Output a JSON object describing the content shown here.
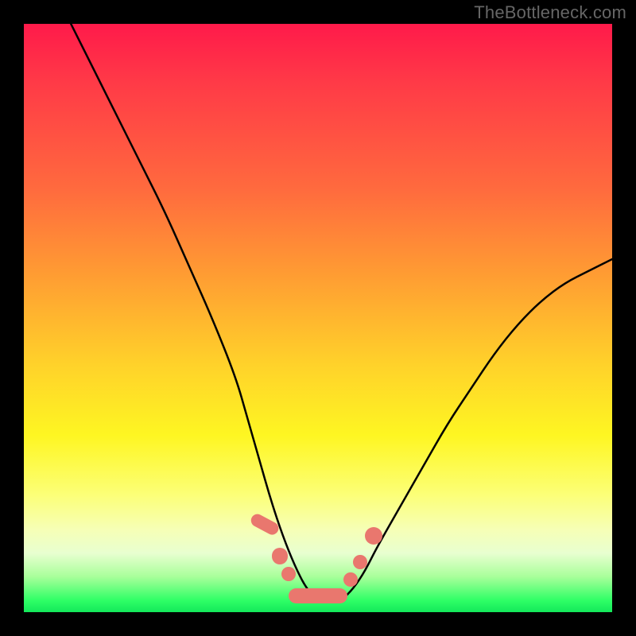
{
  "watermark": "TheBottleneck.com",
  "colors": {
    "frame": "#000000",
    "marker": "#e9776e",
    "curve": "#000000"
  },
  "chart_data": {
    "type": "line",
    "title": "",
    "xlabel": "",
    "ylabel": "",
    "xlim": [
      0,
      100
    ],
    "ylim": [
      0,
      100
    ],
    "grid": false,
    "legend": null,
    "note": "Values in percent of plot area. y=100 is top (red), y=0 is bottom (green). Curve is a V-shaped bottleneck profile with flat bottom and pink markers near the trough.",
    "series": [
      {
        "name": "bottleneck-curve",
        "x": [
          8,
          12,
          16,
          20,
          24,
          28,
          32,
          36,
          38,
          40,
          42,
          44,
          46,
          48,
          50,
          52,
          54,
          56,
          58,
          60,
          64,
          68,
          72,
          76,
          80,
          84,
          88,
          92,
          96,
          100
        ],
        "y": [
          100,
          92,
          84,
          76,
          68,
          59,
          50,
          40,
          33,
          26,
          19,
          13,
          8,
          4,
          2,
          2,
          2,
          4,
          7,
          11,
          18,
          25,
          32,
          38,
          44,
          49,
          53,
          56,
          58,
          60
        ]
      }
    ],
    "markers": [
      {
        "shape": "pill",
        "cx": 41.0,
        "cy": 15.0,
        "w": 2.2,
        "h": 5.0,
        "angle": -62
      },
      {
        "shape": "dot",
        "cx": 43.5,
        "cy": 9.5,
        "r": 1.4
      },
      {
        "shape": "dot",
        "cx": 45.0,
        "cy": 6.5,
        "r": 1.2
      },
      {
        "shape": "pill",
        "cx": 50.0,
        "cy": 2.8,
        "w": 10.0,
        "h": 2.6,
        "angle": 0
      },
      {
        "shape": "dot",
        "cx": 55.5,
        "cy": 5.5,
        "r": 1.2
      },
      {
        "shape": "dot",
        "cx": 57.2,
        "cy": 8.5,
        "r": 1.2
      },
      {
        "shape": "dot",
        "cx": 59.5,
        "cy": 13.0,
        "r": 1.5
      }
    ]
  }
}
